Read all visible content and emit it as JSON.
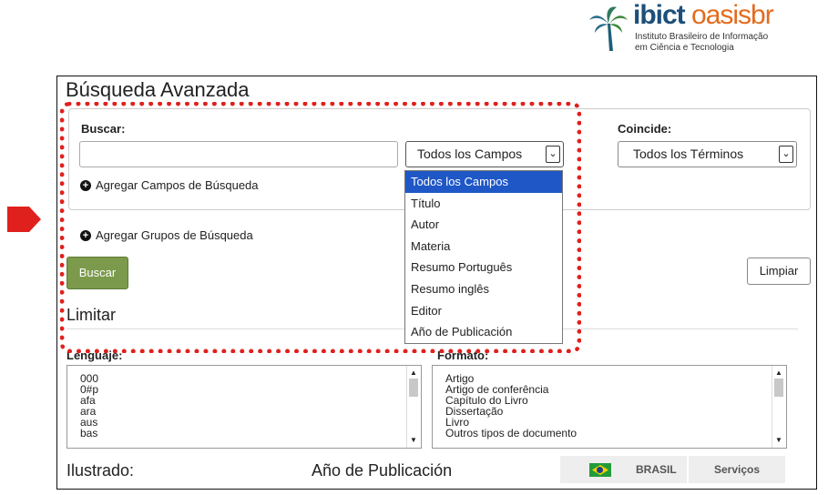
{
  "logo": {
    "brand_part1": "ibict",
    "brand_part2": "oasisbr",
    "subtitle_line1": "Instituto Brasileiro de Informação",
    "subtitle_line2": "em Ciência e Tecnologia"
  },
  "colors": {
    "highlight": "#e0201c",
    "button_green": "#7b9a4b",
    "selection_blue": "#1f57c7"
  },
  "page": {
    "title": "Búsqueda Avanzada"
  },
  "search": {
    "buscar_label": "Buscar:",
    "term_value": "",
    "field_select_value": "Todos los Campos",
    "coincide_label": "Coincide:",
    "match_select_value": "Todos los Términos",
    "add_field_link": "Agregar Campos de Búsqueda",
    "add_group_link": "Agregar Grupos de Búsqueda",
    "buscar_button": "Buscar",
    "limpiar_button": "Limpiar"
  },
  "field_dropdown": {
    "options": [
      "Todos los Campos",
      "Título",
      "Autor",
      "Materia",
      "Resumo Português",
      "Resumo inglês",
      "Editor",
      "Año de Publicación"
    ],
    "selected_index": 0
  },
  "limit": {
    "heading": "Limitar",
    "language_label": "Lenguaje:",
    "language_items": [
      "000",
      "0#p",
      "afa",
      "ara",
      "aus",
      "bas"
    ],
    "format_label": "Formato:",
    "format_items": [
      "Artigo",
      "Artigo de conferência",
      "Capítulo do Livro",
      "Dissertação",
      "Livro",
      "Outros tipos de documento"
    ],
    "ilustrado_label": "Ilustrado:",
    "year_label": "Año de Publicación"
  },
  "footer_bar": {
    "language_button": "BRASIL",
    "services_button": "Serviços"
  }
}
